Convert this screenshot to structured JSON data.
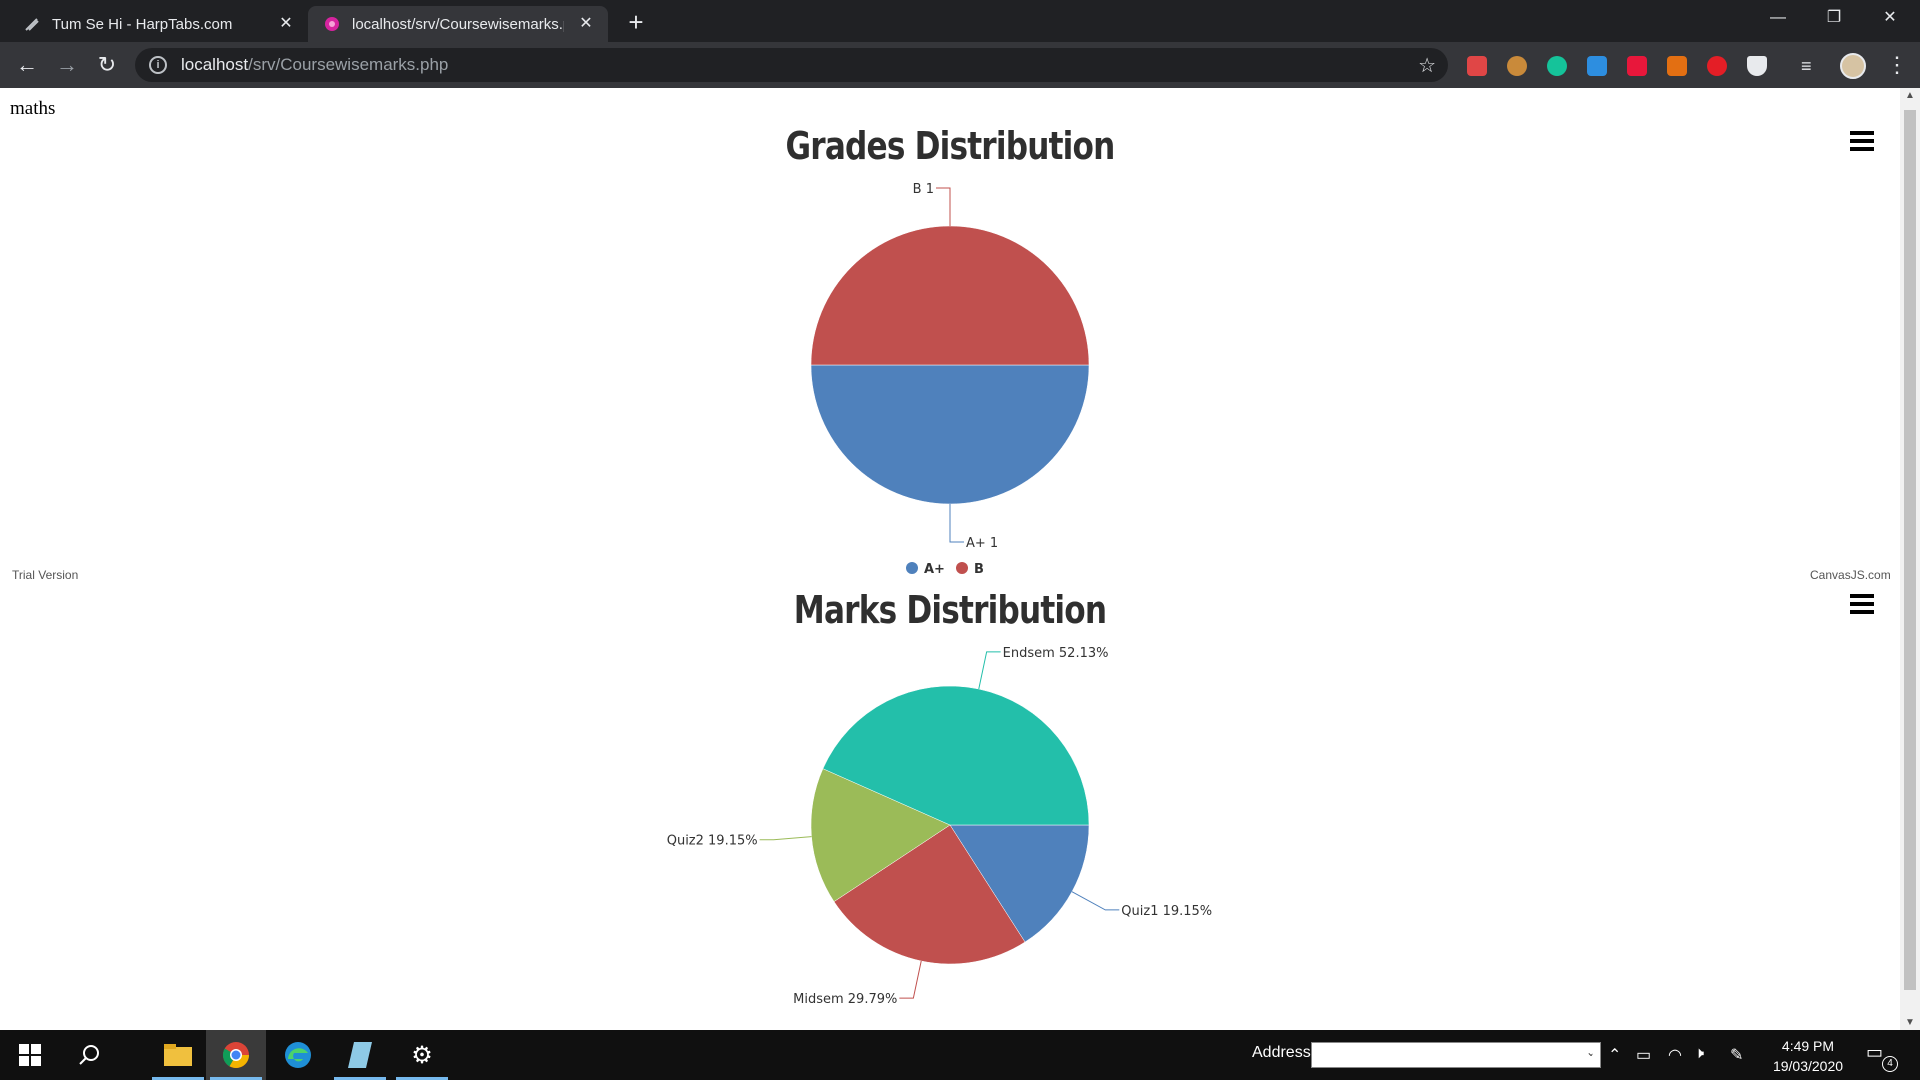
{
  "browser": {
    "tabs": [
      {
        "title": "Tum Se Hi - HarpTabs.com",
        "active": false
      },
      {
        "title": "localhost/srv/Coursewisemarks.php",
        "active": true
      }
    ],
    "url": {
      "host": "localhost",
      "path": "/srv/Coursewisemarks.php"
    }
  },
  "page": {
    "course": "maths",
    "trial_text": "Trial Version",
    "credit_text": "CanvasJS.com"
  },
  "chart_data": [
    {
      "type": "pie",
      "title": "Grades Distribution",
      "categories": [
        "A+",
        "B"
      ],
      "values": [
        1,
        1
      ],
      "labels": [
        "A+ 1",
        "B 1"
      ],
      "colors": [
        "#4f81bc",
        "#c0504e"
      ],
      "legend": "bottom-center"
    },
    {
      "type": "pie",
      "title": "Marks Distribution",
      "categories": [
        "Quiz1",
        "Midsem",
        "Quiz2",
        "Endsem"
      ],
      "values": [
        19.15,
        29.79,
        19.15,
        52.13
      ],
      "labels": [
        "Quiz1 19.15%",
        "Midsem 29.79%",
        "Quiz2 19.15%",
        "Endsem 52.13%"
      ],
      "colors": [
        "#4f81bc",
        "#c0504e",
        "#9bbb58",
        "#23bfaa"
      ]
    }
  ],
  "taskbar": {
    "address_label": "Address",
    "time": "4:49 PM",
    "date": "19/03/2020",
    "notification_count": "4"
  }
}
